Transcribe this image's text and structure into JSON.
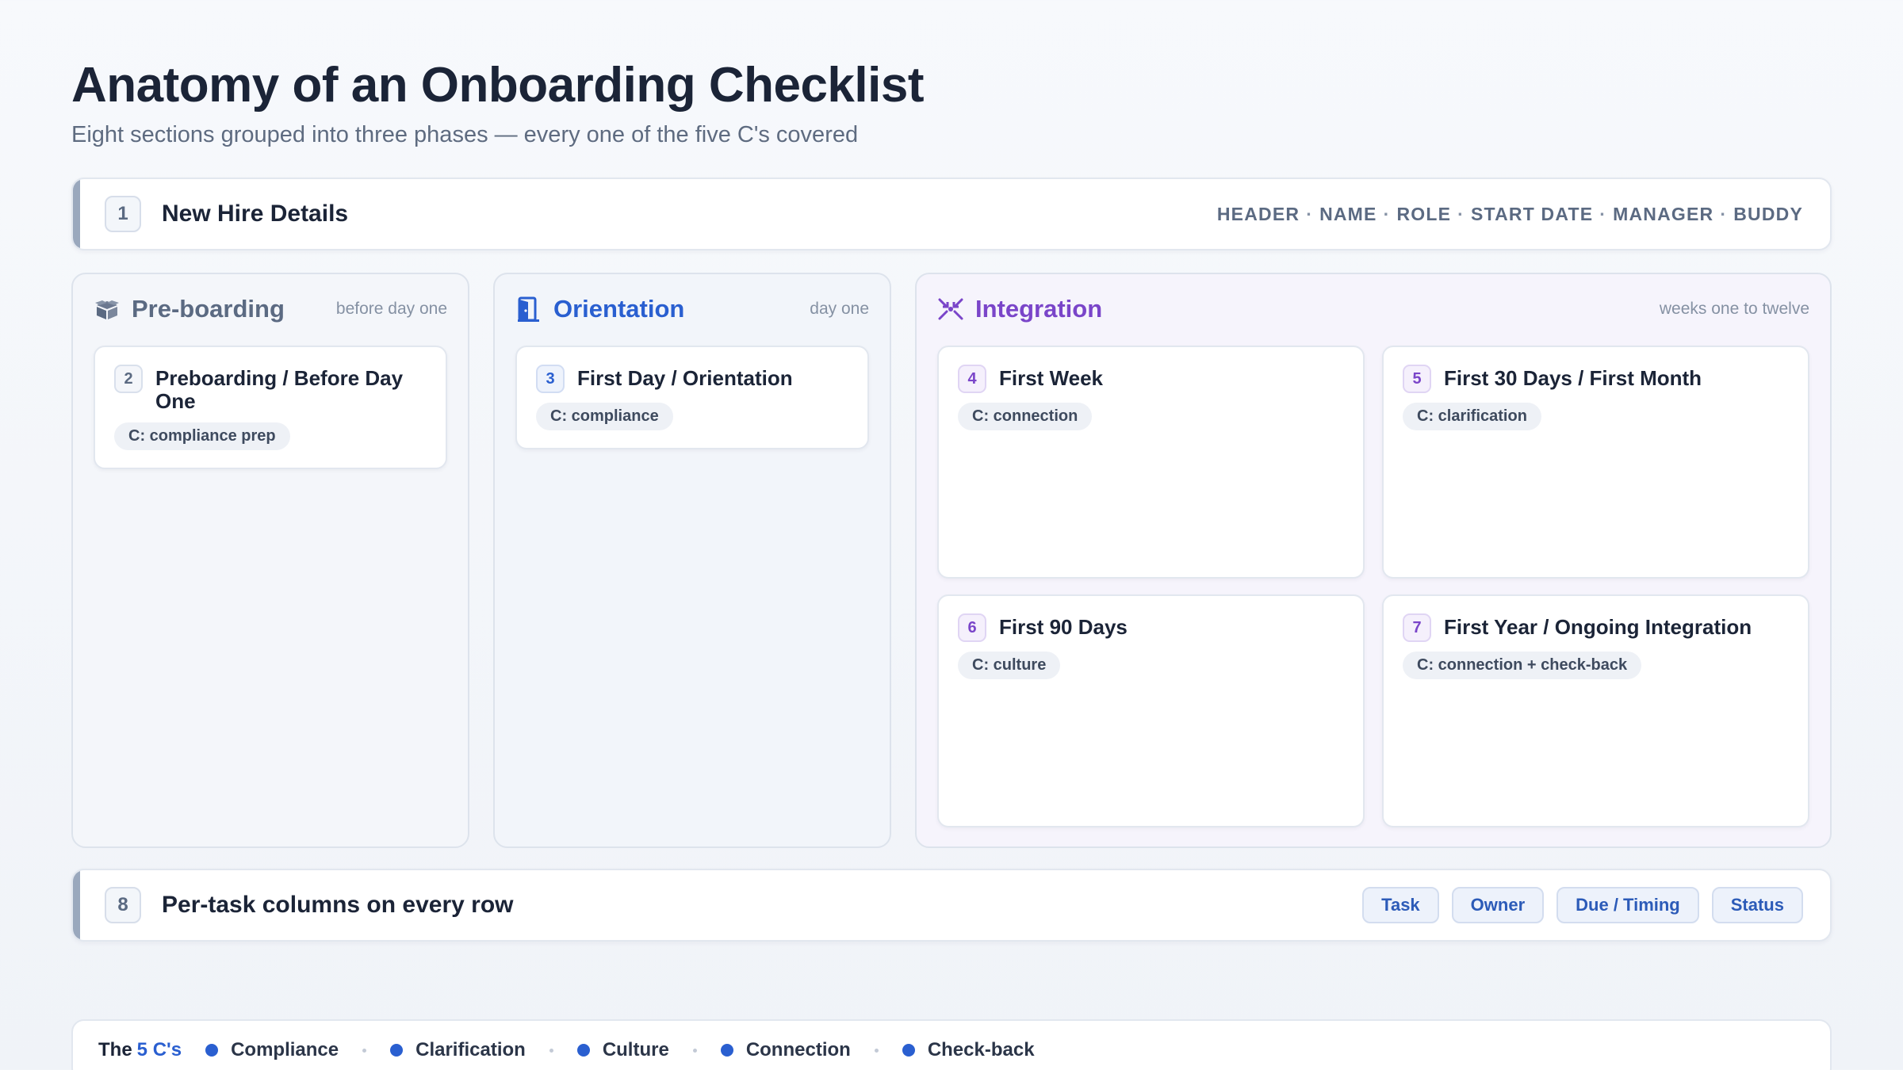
{
  "header": {
    "title": "Anatomy of an Onboarding Checklist",
    "subtitle": "Eight sections grouped into three phases — every one of the five C's covered"
  },
  "section_header": {
    "number": "1",
    "title": "New Hire Details",
    "fields": [
      "HEADER",
      "NAME",
      "ROLE",
      "START DATE",
      "MANAGER",
      "BUDDY"
    ],
    "separator": "·"
  },
  "phases": {
    "preboarding": {
      "title": "Pre-boarding",
      "when": "before day one",
      "icon": "box-icon",
      "cards": [
        {
          "number": "2",
          "title": "Preboarding / Before Day One",
          "tag": "C: compliance prep"
        }
      ]
    },
    "orientation": {
      "title": "Orientation",
      "when": "day one",
      "icon": "door-icon",
      "cards": [
        {
          "number": "3",
          "title": "First Day / Orientation",
          "tag": "C: compliance"
        }
      ]
    },
    "integration": {
      "title": "Integration",
      "when": "weeks one to twelve",
      "icon": "merge-arrows-icon",
      "cards": [
        {
          "number": "4",
          "title": "First Week",
          "tag": "C: connection"
        },
        {
          "number": "5",
          "title": "First 30 Days / First Month",
          "tag": "C: clarification"
        },
        {
          "number": "6",
          "title": "First 90 Days",
          "tag": "C: culture"
        },
        {
          "number": "7",
          "title": "First Year / Ongoing Integration",
          "tag": "C: connection + check-back"
        }
      ]
    }
  },
  "section_columns": {
    "number": "8",
    "title": "Per-task columns on every row",
    "columns": [
      "Task",
      "Owner",
      "Due / Timing",
      "Status"
    ]
  },
  "legend": {
    "lead": "The",
    "lead_accent": "5 C's",
    "items": [
      "Compliance",
      "Clarification",
      "Culture",
      "Connection",
      "Check-back"
    ]
  },
  "colors": {
    "preboarding": "#5b6a82",
    "orientation": "#2a5fd0",
    "integration": "#7a45c9",
    "legend_bullet": "#2a5fd0"
  }
}
